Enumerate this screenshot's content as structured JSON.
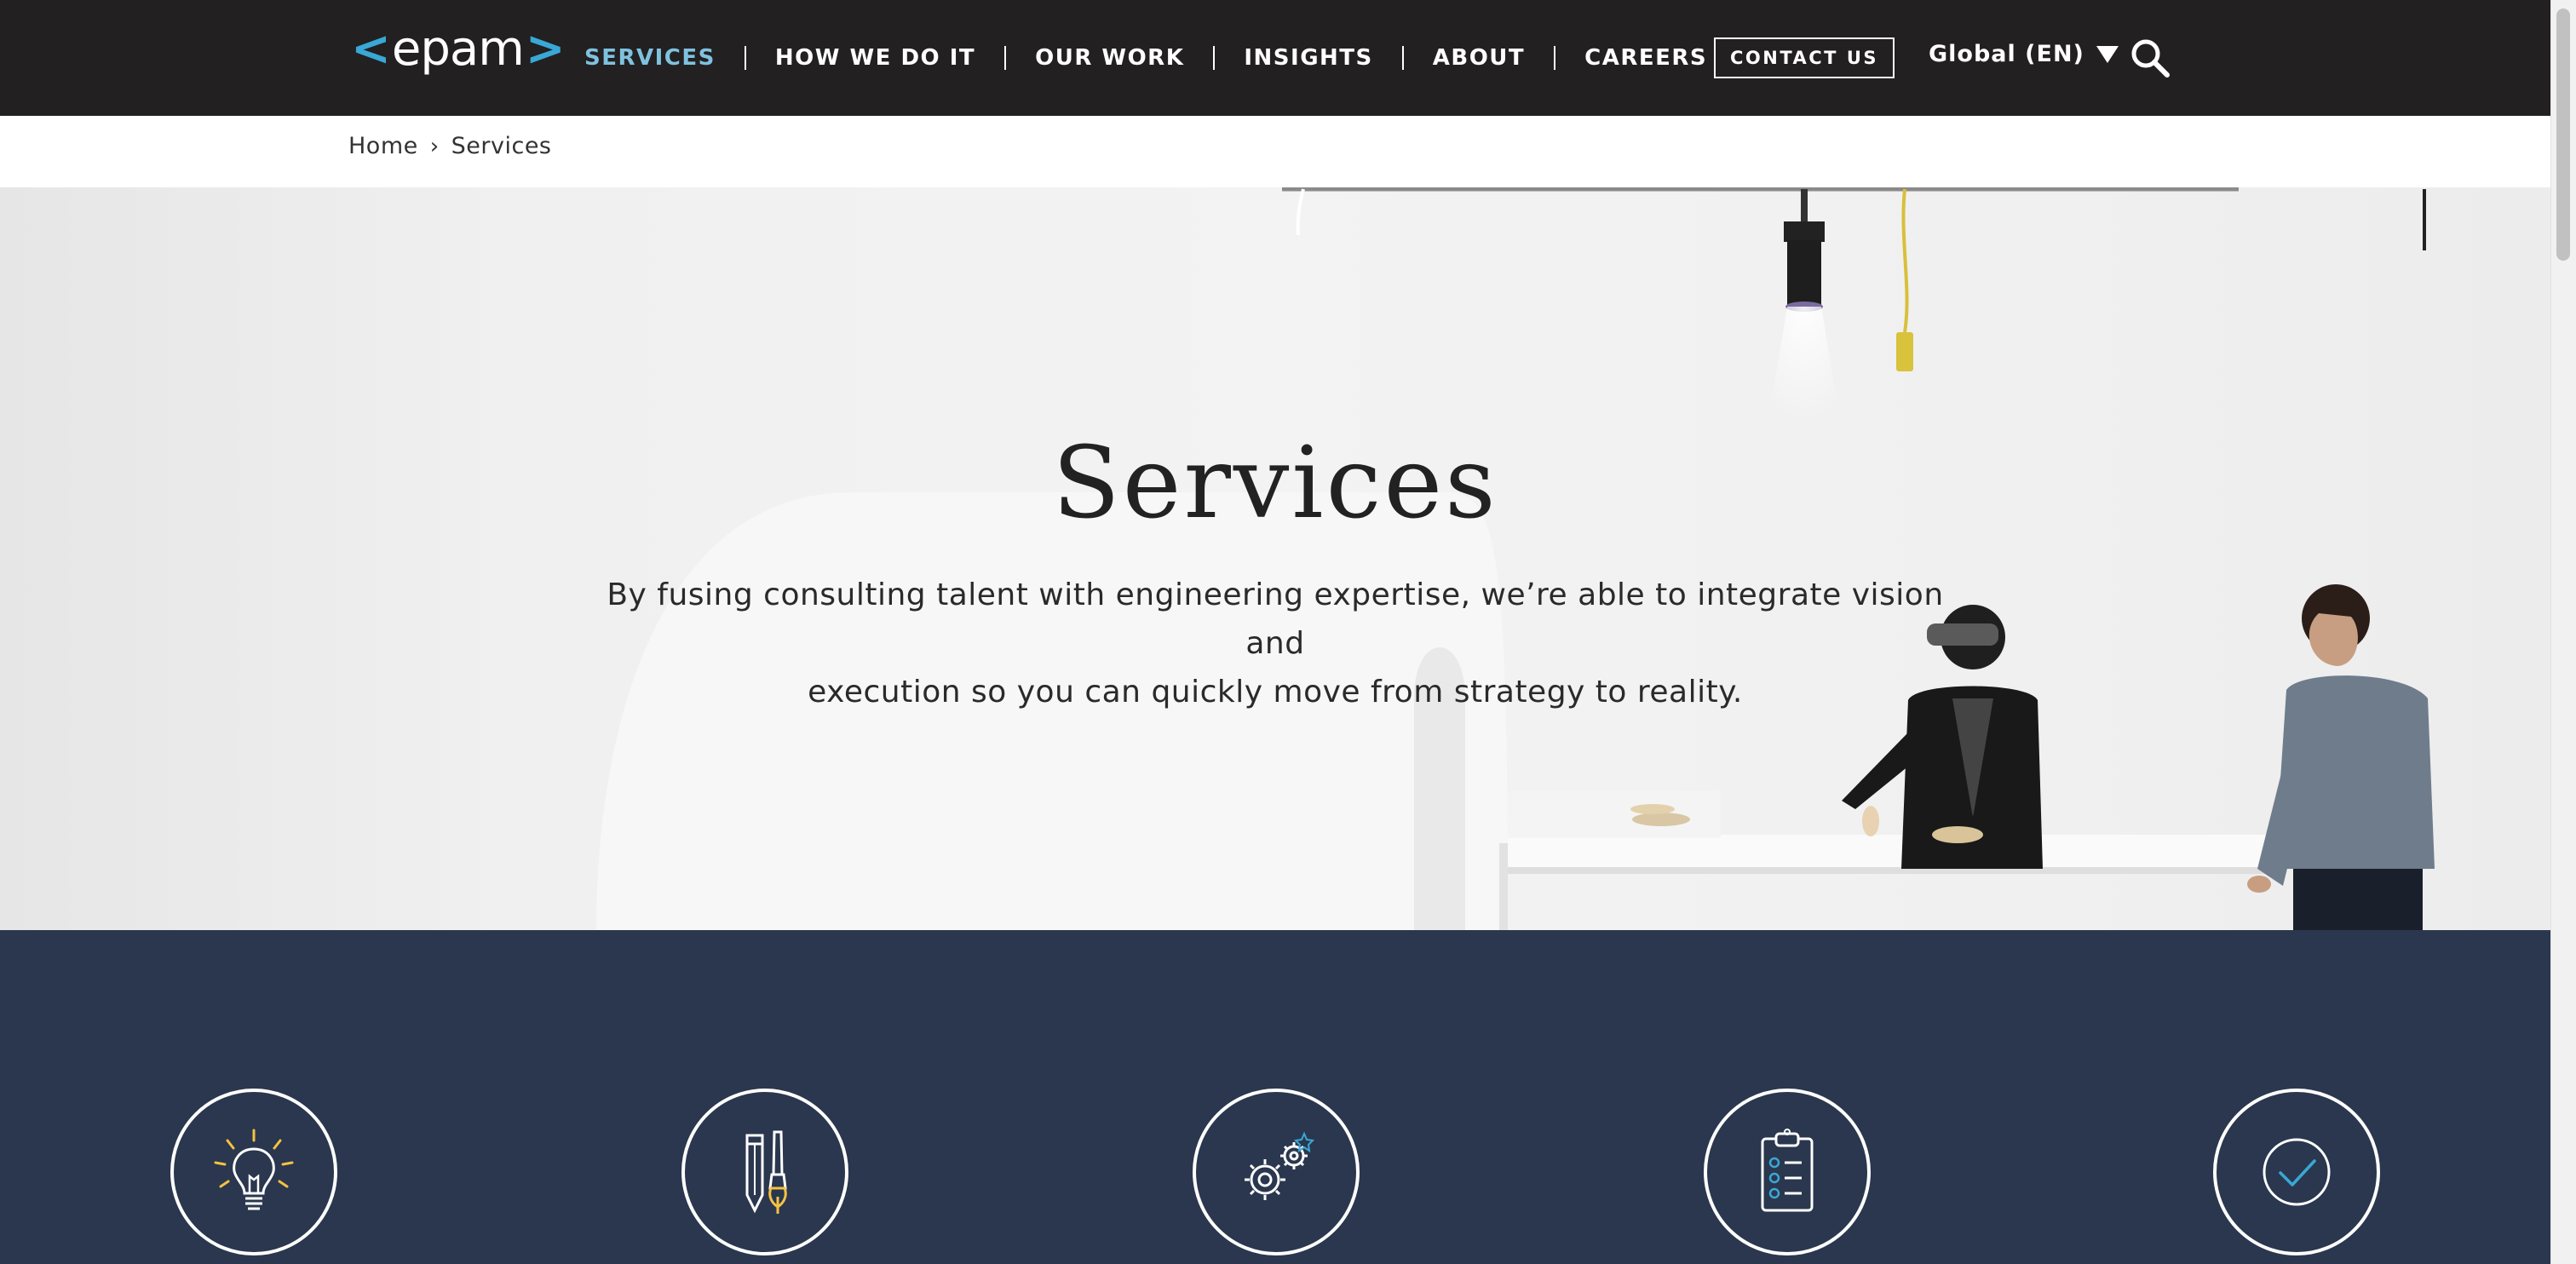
{
  "header": {
    "logo_text": "epam",
    "nav": [
      {
        "label": "SERVICES",
        "active": true
      },
      {
        "label": "HOW WE DO IT"
      },
      {
        "label": "OUR WORK"
      },
      {
        "label": "INSIGHTS"
      },
      {
        "label": "ABOUT"
      },
      {
        "label": "CAREERS"
      }
    ],
    "contact_label": "CONTACT US",
    "language_label": "Global (EN)",
    "colors": {
      "background": "#222021",
      "active_nav": "#7fc2df",
      "logo_accent": "#39a8d6"
    }
  },
  "breadcrumb": {
    "home": "Home",
    "separator": "›",
    "current": "Services"
  },
  "hero": {
    "title": "Services",
    "subtitle_line1": "By fusing consulting talent with engineering expertise, we’re able to integrate vision and",
    "subtitle_line2": "execution so you can quickly move from strategy to reality."
  },
  "services_band": {
    "background": "#2a374e",
    "icons": [
      "lightbulb-icon",
      "pencil-brush-icon",
      "gears-icon",
      "clipboard-checklist-icon",
      "checkmark-circle-icon"
    ]
  }
}
